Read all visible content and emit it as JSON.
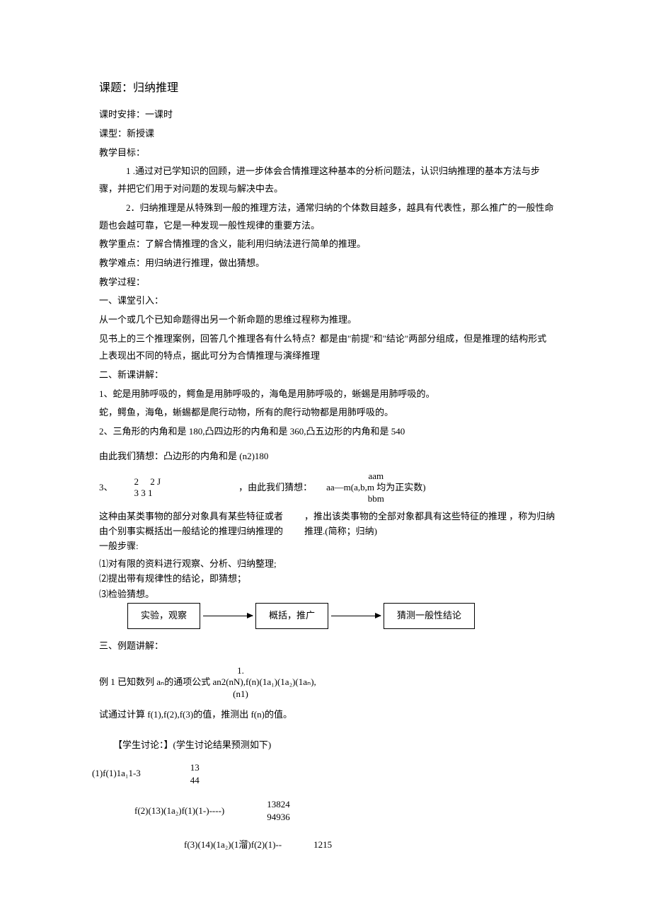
{
  "title": "课题：归纳推理",
  "schedule": "课时安排：一课时",
  "type": "课型：新授课",
  "goal_heading": "教学目标：",
  "goal_1": "1 .通过对已学知识的回顾，进一步体会合情推理这种基本的分析问题法，认识归纳推理的基本方法与步骤，并把它们用于对问题的发现与解决中去。",
  "goal_2": "2．归纳推理是从特殊到一般的推理方法，通常归纳的个体数目越多，越具有代表性，那么推广的一般性命题也会越可靠，它是一种发现一般性规律的重要方法。",
  "key": "教学重点：了解合情推理的含义，能利用归纳法进行简单的推理。",
  "diff": "教学难点：用归纳进行推理，做出猜想。",
  "process": "教学过程：",
  "sec1_title": "一、课堂引入：",
  "sec1_p1": "从一个或几个已知命题得出另一个新命题的思维过程称为推理。",
  "sec1_p2": "见书上的三个推理案例，回答几个推理各有什么特点？都是由\"前提\"和\"结论\"两部分组成，但是推理的结构形式上表现出不同的特点，据此可分为合情推理与演绎推理",
  "sec2_title": "二、新课讲解：",
  "sec2_p1": "1、蛇是用肺呼吸的，鳄鱼是用肺呼吸的，海龟是用肺呼吸的，蜥蜴是用肺呼吸的。",
  "sec2_p2": "蛇，鳄鱼，海龟，蜥蜴都是爬行动物，所有的爬行动物都是用肺呼吸的。",
  "sec2_p3": "2、三角形的内角和是 180,凸四边形的内角和是 360,凸五边形的内角和是 540",
  "sec2_p4": "由此我们猜想：凸边形的内角和是 (n2)180",
  "frac_prefix": "3、",
  "frac_top": "2  2 J",
  "frac_bot": "3 3 1",
  "frac_mid": "，由此我们猜想：",
  "frac_r_top": "aam",
  "frac_r_mid": "aa—m(a,b,m 均为正实数)",
  "frac_r_bot": "bbm",
  "def_p1": "这种由某类事物的部分对象具有某些特征或者由个别事实概括出一般结论的推理归纳推理的一般步骤:",
  "def_p2": "，推出该类事物的全部对象都具有这些特征的推理  ，称为归纳推理.(简称；归纳)",
  "step1": "⑴对有限的资料进行观察、分析、归纳整理;",
  "step2": "⑵提出带有规律性的结论，即猜想；",
  "step3": "⑶检验猜想。",
  "flow": {
    "b1": "实验，观察",
    "b2": "概括，推广",
    "b3": "猜测一般性结论"
  },
  "sec3_title": "三、例题讲解：",
  "ex1_top": "1.",
  "ex1_main": "例 1 已知数列 aₙ的通项公式 an2(nN),f(n)(1a₁)(1a₂)(1aₙ),",
  "ex1_sub": "(n1)",
  "ex1_p2": "试通过计算 f(1),f(2),f(3)的值，推测出 f(n)的值。",
  "student": "【学生讨论：】(学生讨论结果预测如下)",
  "c1_left": "(1)f(1)1a₁1-3",
  "c1_r1": "13",
  "c1_r2": "44",
  "c2_left": "f(2)(13)(1a₂)f(1)(1-)----)",
  "c2_r1": "13824",
  "c2_r2": "94936",
  "c3_left": "f(3)(14)(1a₂)(1溜)f(2)(1)--",
  "c3_right": "1215"
}
